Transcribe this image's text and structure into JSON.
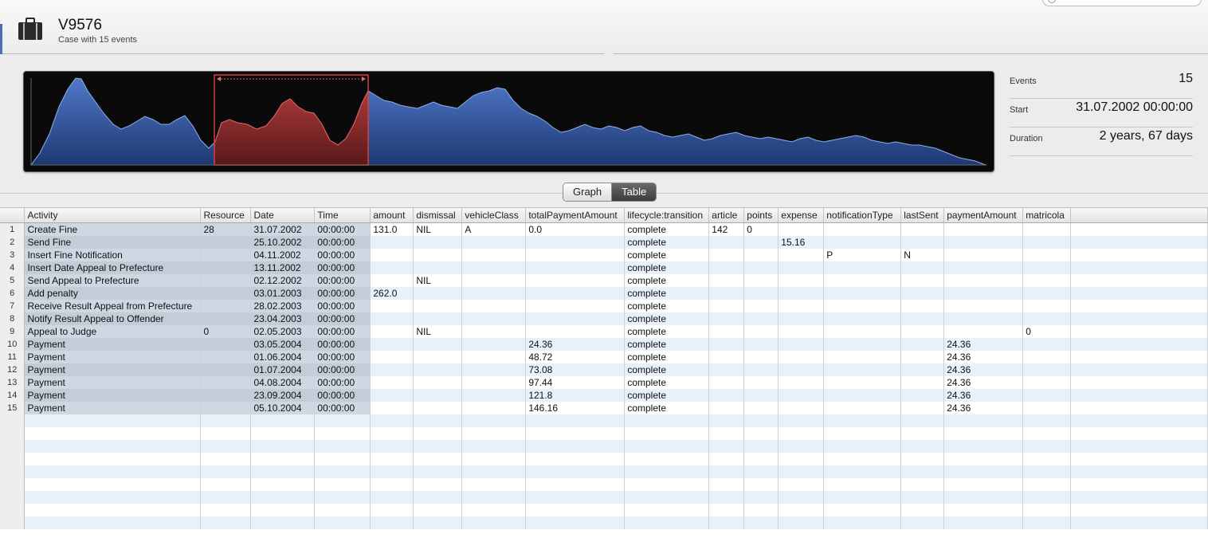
{
  "case": {
    "id": "V9576",
    "subtitle": "Case with 15 events"
  },
  "stats": [
    {
      "label": "Events",
      "value": "15"
    },
    {
      "label": "Start",
      "value": "31.07.2002 00:00:00"
    },
    {
      "label": "Duration",
      "value": "2 years, 67 days"
    }
  ],
  "view_toggle": {
    "graph_label": "Graph",
    "table_label": "Table",
    "selected": "Table"
  },
  "colors": {
    "accent": "#4a6fb4",
    "chart_fill": "#3a5ca8",
    "selection": "#b83232"
  },
  "icons": [
    "briefcase-icon",
    "search-icon"
  ],
  "table": {
    "columns": [
      "Activity",
      "Resource",
      "Date",
      "Time",
      "amount",
      "dismissal",
      "vehicleClass",
      "totalPaymentAmount",
      "lifecycle:transition",
      "article",
      "points",
      "expense",
      "notificationType",
      "lastSent",
      "paymentAmount",
      "matricola"
    ],
    "rows": [
      [
        "1",
        "Create Fine",
        "28",
        "31.07.2002",
        "00:00:00",
        "131.0",
        "NIL",
        "A",
        "0.0",
        "complete",
        "142",
        "0",
        "",
        "",
        "",
        "",
        ""
      ],
      [
        "2",
        "Send Fine",
        "",
        "25.10.2002",
        "00:00:00",
        "",
        "",
        "",
        "",
        "complete",
        "",
        "",
        "15.16",
        "",
        "",
        "",
        ""
      ],
      [
        "3",
        "Insert Fine Notification",
        "",
        "04.11.2002",
        "00:00:00",
        "",
        "",
        "",
        "",
        "complete",
        "",
        "",
        "",
        "P",
        "N",
        "",
        ""
      ],
      [
        "4",
        "Insert Date Appeal to Prefecture",
        "",
        "13.11.2002",
        "00:00:00",
        "",
        "",
        "",
        "",
        "complete",
        "",
        "",
        "",
        "",
        "",
        "",
        ""
      ],
      [
        "5",
        "Send Appeal to Prefecture",
        "",
        "02.12.2002",
        "00:00:00",
        "",
        "NIL",
        "",
        "",
        "complete",
        "",
        "",
        "",
        "",
        "",
        "",
        ""
      ],
      [
        "6",
        "Add penalty",
        "",
        "03.01.2003",
        "00:00:00",
        "262.0",
        "",
        "",
        "",
        "complete",
        "",
        "",
        "",
        "",
        "",
        "",
        ""
      ],
      [
        "7",
        "Receive Result Appeal from Prefecture",
        "",
        "28.02.2003",
        "00:00:00",
        "",
        "",
        "",
        "",
        "complete",
        "",
        "",
        "",
        "",
        "",
        "",
        ""
      ],
      [
        "8",
        "Notify Result Appeal to Offender",
        "",
        "23.04.2003",
        "00:00:00",
        "",
        "",
        "",
        "",
        "complete",
        "",
        "",
        "",
        "",
        "",
        "",
        ""
      ],
      [
        "9",
        "Appeal to Judge",
        "0",
        "02.05.2003",
        "00:00:00",
        "",
        "NIL",
        "",
        "",
        "complete",
        "",
        "",
        "",
        "",
        "",
        "",
        "0"
      ],
      [
        "10",
        "Payment",
        "",
        "03.05.2004",
        "00:00:00",
        "",
        "",
        "",
        "24.36",
        "complete",
        "",
        "",
        "",
        "",
        "",
        "24.36",
        ""
      ],
      [
        "11",
        "Payment",
        "",
        "01.06.2004",
        "00:00:00",
        "",
        "",
        "",
        "48.72",
        "complete",
        "",
        "",
        "",
        "",
        "",
        "24.36",
        ""
      ],
      [
        "12",
        "Payment",
        "",
        "01.07.2004",
        "00:00:00",
        "",
        "",
        "",
        "73.08",
        "complete",
        "",
        "",
        "",
        "",
        "",
        "24.36",
        ""
      ],
      [
        "13",
        "Payment",
        "",
        "04.08.2004",
        "00:00:00",
        "",
        "",
        "",
        "97.44",
        "complete",
        "",
        "",
        "",
        "",
        "",
        "24.36",
        ""
      ],
      [
        "14",
        "Payment",
        "",
        "23.09.2004",
        "00:00:00",
        "",
        "",
        "",
        "121.8",
        "complete",
        "",
        "",
        "",
        "",
        "",
        "24.36",
        ""
      ],
      [
        "15",
        "Payment",
        "",
        "05.10.2004",
        "00:00:00",
        "",
        "",
        "",
        "146.16",
        "complete",
        "",
        "",
        "",
        "",
        "",
        "24.36",
        ""
      ]
    ]
  }
}
